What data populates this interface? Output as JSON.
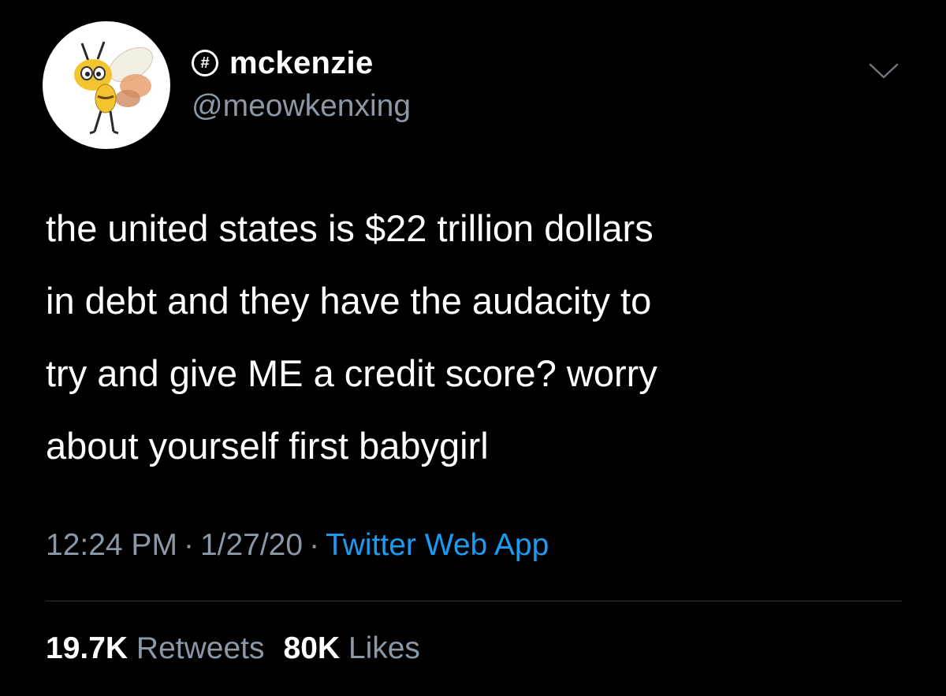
{
  "user": {
    "display_name": "mckenzie",
    "handle": "@meowkenxing",
    "badge_icon": "hash-circle-icon",
    "badge_glyph": "#"
  },
  "tweet": {
    "text_lines": [
      "the united states is $22 trillion dollars",
      "in debt and they have the audacity to",
      "try and give ME a credit score? worry",
      "about yourself first babygirl"
    ],
    "time": "12:24 PM",
    "date": "1/27/20",
    "separator": "·",
    "source": "Twitter Web App"
  },
  "stats": {
    "retweets_count": "19.7K",
    "retweets_label": "Retweets",
    "likes_count": "80K",
    "likes_label": "Likes"
  },
  "colors": {
    "background": "#000000",
    "text": "#ffffff",
    "secondary_text": "#8b98a5",
    "link": "#1d9bf0",
    "divider": "#2f3336"
  }
}
